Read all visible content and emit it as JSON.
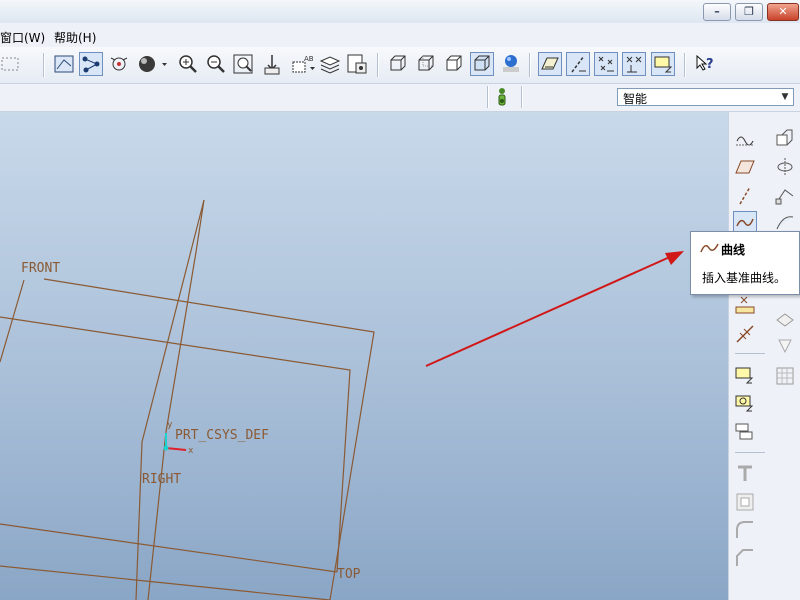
{
  "menubar": {
    "items": [
      {
        "label": "窗口(W)"
      },
      {
        "label": "帮助(H)"
      }
    ]
  },
  "window_controls": {
    "minimize": "–",
    "restore": "❐",
    "close": "✕"
  },
  "toolbar": {
    "icons": [
      "select-icon",
      "datum-display-icon",
      "datum-points-icon",
      "sphere-view-icon",
      "zoom-in-icon",
      "zoom-out-icon",
      "refit-icon",
      "reorient-icon",
      "saved-views-icon",
      "layers-icon",
      "view-manager-icon",
      "wireframe-icon",
      "hidden-line-icon",
      "no-hidden-icon",
      "shading-icon",
      "appearance-icon",
      "plane-toggle-icon",
      "axis-toggle-icon",
      "point-toggle-icon",
      "csys-toggle-icon",
      "annotation-toggle-icon",
      "whats-this-icon"
    ]
  },
  "status": {
    "filter_value": "智能"
  },
  "datums": {
    "front": "FRONT",
    "right": "RIGHT",
    "top": "TOP",
    "csys": "PRT_CSYS_DEF",
    "csys_x": "x",
    "csys_y": "y"
  },
  "tooltip": {
    "title": "曲线",
    "description": "插入基准曲线。"
  },
  "colors": {
    "datum": "#8a5a34",
    "arrow": "#d01818",
    "accent": "#3a6fb0"
  }
}
